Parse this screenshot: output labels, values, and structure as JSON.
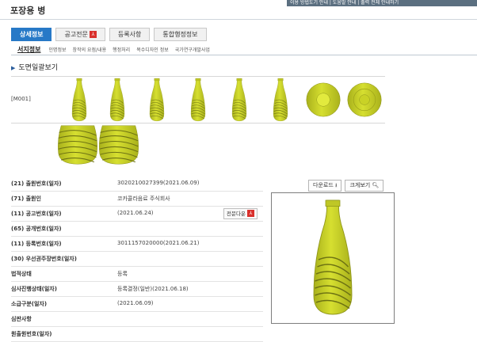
{
  "page": {
    "title": "포장용 병",
    "top_links": "이용 방법도기 안내 | 도움말 안내 | 출력 전체 안내하기"
  },
  "tabs": [
    {
      "label": "상세정보",
      "active": true
    },
    {
      "label": "공고전문",
      "pdf": true
    },
    {
      "label": "등록사항"
    },
    {
      "label": "통합행정정보"
    }
  ],
  "subtabs": {
    "active": "서지정보",
    "items": [
      "인명정보",
      "창작의 요점/내용",
      "행정처리",
      "복수디자인 정보",
      "국가연구개발사업"
    ]
  },
  "gallery": {
    "heading": "도면일괄보기",
    "code": "[M001]",
    "views": [
      "front",
      "back",
      "left",
      "right",
      "perspective-1",
      "perspective-2",
      "top",
      "bottom",
      "detail-1",
      "detail-2"
    ]
  },
  "info": [
    {
      "label": "(21) 출원번호(일자)",
      "value": "3020210027399(2021.06.09)"
    },
    {
      "label": "(71) 출원인",
      "value": "코카콜라음료 주식회사"
    },
    {
      "label": "(11) 공고번호(일자)",
      "value": "(2021.06.24)",
      "button": "전문다운"
    },
    {
      "label": "(65) 공개번호(일자)",
      "value": ""
    },
    {
      "label": "(11) 등록번호(일자)",
      "value": "3011157020000(2021.06.21)"
    },
    {
      "label": "(30) 우선권주장번호(일자)",
      "value": ""
    },
    {
      "label": "법적상태",
      "value": "등록"
    },
    {
      "label": "심사진행상태(일자)",
      "value": "등록결정(일반)(2021.06.18)"
    },
    {
      "label": "소급구분(일자)",
      "value": "(2021.06.09)"
    },
    {
      "label": "심판사항",
      "value": ""
    },
    {
      "label": "원출원번호(일자)",
      "value": ""
    }
  ],
  "panel": {
    "download_label": "다운로드",
    "zoom_label": "크게보기"
  },
  "colors": {
    "bottle_fill": "#d3dc2a",
    "bottle_shade": "#a9b11c",
    "tab_active": "#2779c7",
    "pdf_badge": "#d9302c"
  }
}
